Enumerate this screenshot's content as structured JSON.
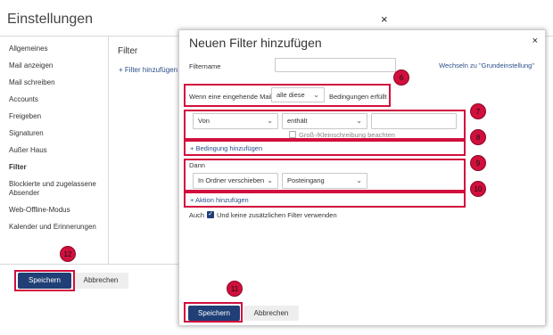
{
  "settings": {
    "title": "Einstellungen",
    "close_icon": "×",
    "sidebar": [
      {
        "label": "Allgemeines"
      },
      {
        "label": "Mail anzeigen"
      },
      {
        "label": "Mail schreiben"
      },
      {
        "label": "Accounts"
      },
      {
        "label": "Freigeben"
      },
      {
        "label": "Signaturen"
      },
      {
        "label": "Außer Haus"
      },
      {
        "label": "Filter",
        "active": true
      },
      {
        "label": "Blockierte und zugelassene Absender"
      },
      {
        "label": "Web-Offline-Modus"
      },
      {
        "label": "Kalender und Erinnerungen"
      }
    ],
    "content_title": "Filter",
    "add_filter_link": "+ Filter hinzufügen",
    "save_label": "Speichern",
    "cancel_label": "Abbrechen"
  },
  "dialog": {
    "title": "Neuen Filter hinzufügen",
    "close_icon": "×",
    "filtername_label": "Filtername",
    "filtername_value": "",
    "switch_link": "Wechseln zu \"Grundeinstellung\"",
    "condition_prefix": "Wenn eine eingehende Mail",
    "condition_select": "alle diese",
    "condition_suffix": "Bedingungen erfüllt",
    "field_select": "Von",
    "operator_select": "enthält",
    "condition_value": "",
    "case_sensitive_label": "Groß-/Kleinschreibung beachten",
    "add_condition_link": "+ Bedingung hinzufügen",
    "then_label": "Dann",
    "action_select": "In Ordner verschieben",
    "folder_select": "Posteingang",
    "add_action_link": "+ Aktion hinzufügen",
    "also_label": "Auch",
    "no_more_filters_label": "Und keine zusätzlichen Filter verwenden",
    "no_more_filters_checked": true,
    "save_label": "Speichern",
    "cancel_label": "Abbrechen"
  },
  "callouts": [
    "6",
    "7",
    "8",
    "9",
    "10",
    "11",
    "12"
  ],
  "colors": {
    "accent": "#1f3f76",
    "callout": "#d10f3d",
    "link": "#2a4f8a"
  }
}
